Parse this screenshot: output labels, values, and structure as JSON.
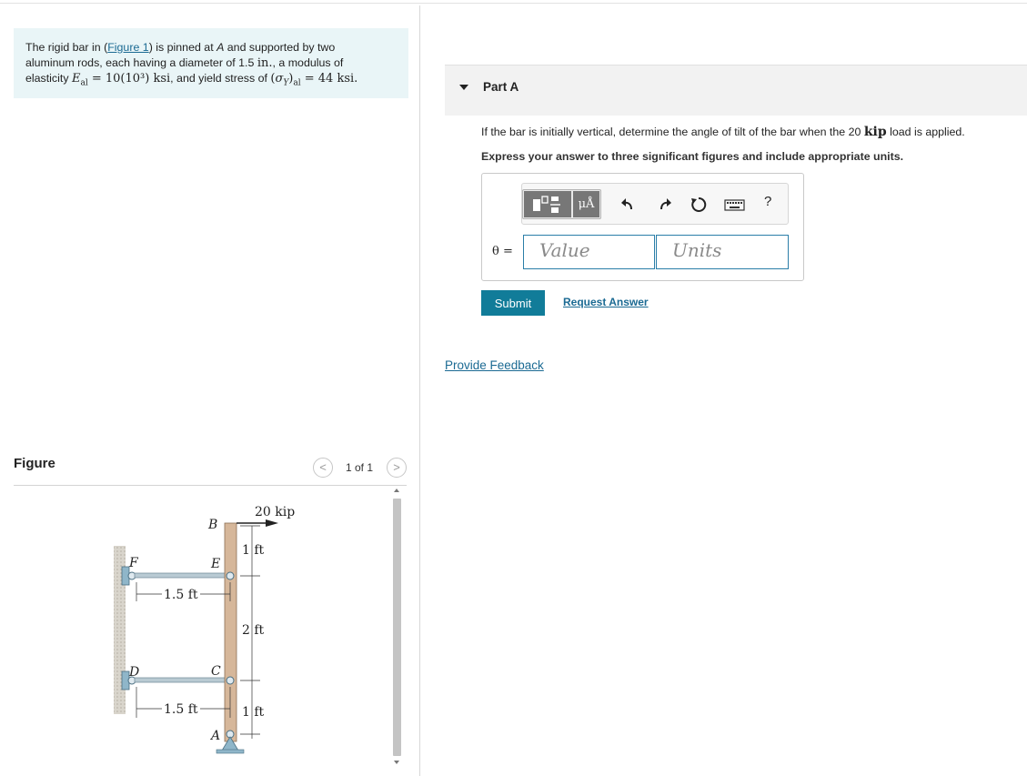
{
  "problem": {
    "text_1": "The rigid bar in (",
    "figure_link": "Figure 1",
    "text_2": ") is pinned at ",
    "point_a": "A",
    "text_3": " and supported by two",
    "line_2": "aluminum rods, each having a diameter of 1.5 ",
    "inch_unit": "in.",
    "text_4": ", a modulus of",
    "line_3_start": "elasticity ",
    "modulus_math": "10(10³) ksi",
    "text_5": ", and yield stress of ",
    "yield_math": "= 44 ksi."
  },
  "figure": {
    "title": "Figure",
    "pager_label": "1 of 1",
    "prev_symbol": "<",
    "next_symbol": ">",
    "labels": {
      "B": "B",
      "E": "E",
      "C": "C",
      "A": "A",
      "F": "F",
      "D": "D",
      "load": "20 kip",
      "dim_top": "1 ft",
      "dim_mid": "2 ft",
      "dim_bot": "1 ft",
      "rod_len_top": "1.5 ft",
      "rod_len_bot": "1.5 ft"
    }
  },
  "part": {
    "title": "Part A",
    "question_pre": "If the bar is initially vertical, determine the angle of tilt of the bar when the 20 ",
    "question_kip": "kip",
    "question_post": " load is applied.",
    "instruction": "Express your answer to three significant figures and include appropriate units.",
    "answer_label": "θ =",
    "value_placeholder": "Value",
    "units_placeholder": "Units",
    "units_button": "μÅ",
    "help": "?"
  },
  "actions": {
    "submit": "Submit",
    "request_answer": "Request Answer",
    "provide_feedback": "Provide Feedback"
  }
}
